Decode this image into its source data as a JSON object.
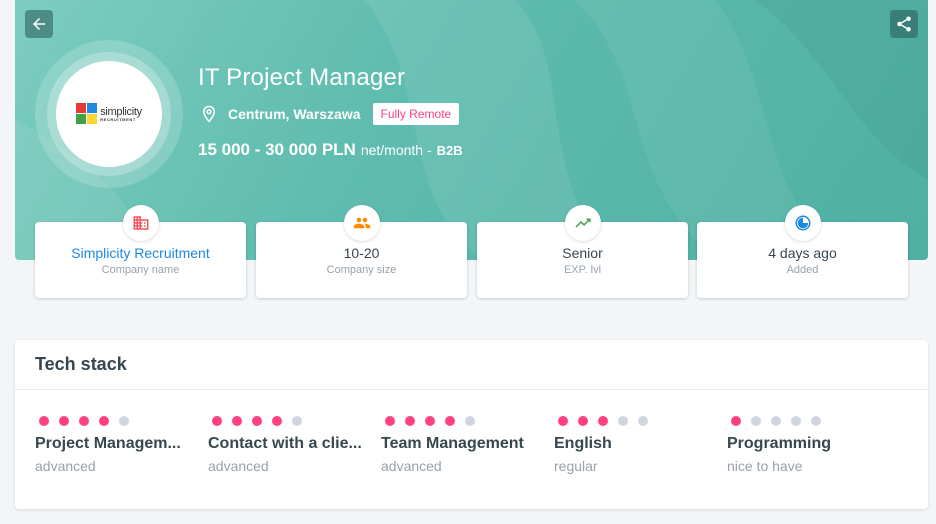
{
  "header": {
    "title": "IT Project Manager",
    "location": "Centrum, Warszawa",
    "remote_badge": "Fully Remote",
    "salary_range": "15 000 - 30 000 PLN",
    "salary_unit": "net/month -",
    "contract_type": "B2B",
    "logo": {
      "word": "simplicity",
      "sub": "RECRUITMENT"
    }
  },
  "info_cards": [
    {
      "value": "Simplicity Recruitment",
      "label": "Company name",
      "icon": "building-icon",
      "color": "#f0545c"
    },
    {
      "value": "10-20",
      "label": "Company size",
      "icon": "people-icon",
      "color": "#fb8c00"
    },
    {
      "value": "Senior",
      "label": "EXP. lvl",
      "icon": "trend-up-icon",
      "color": "#43a047"
    },
    {
      "value": "4 days ago",
      "label": "Added",
      "icon": "clock-icon",
      "color": "#1e88e5"
    }
  ],
  "tech_stack": {
    "title": "Tech stack",
    "skills": [
      {
        "name": "Project Managem...",
        "level": "advanced",
        "rating": 4,
        "max": 5
      },
      {
        "name": "Contact with a clie...",
        "level": "advanced",
        "rating": 4,
        "max": 5
      },
      {
        "name": "Team Management",
        "level": "advanced",
        "rating": 4,
        "max": 5
      },
      {
        "name": "English",
        "level": "regular",
        "rating": 3,
        "max": 5
      },
      {
        "name": "Programming",
        "level": "nice to have",
        "rating": 1,
        "max": 5
      }
    ]
  },
  "colors": {
    "accent": "#ff4081",
    "hero": "#5fbcae",
    "link": "#1e88e5"
  }
}
